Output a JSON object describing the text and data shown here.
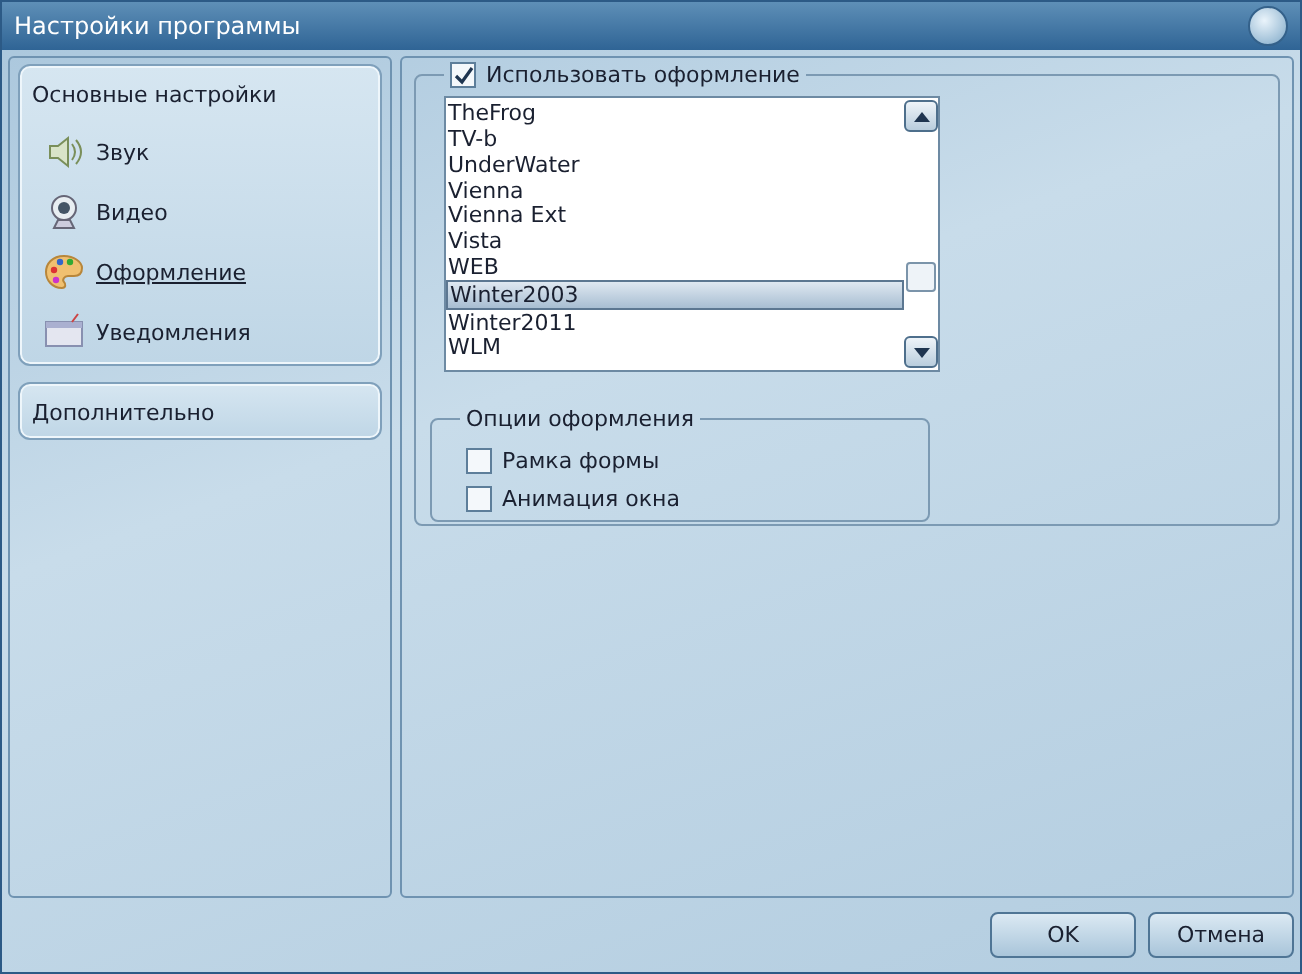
{
  "window": {
    "title": "Настройки программы"
  },
  "sidebar": {
    "sections": [
      {
        "title": "Основные настройки",
        "items": [
          {
            "label": "Звук",
            "selected": false
          },
          {
            "label": "Видео",
            "selected": false
          },
          {
            "label": "Оформление",
            "selected": true
          },
          {
            "label": "Уведомления",
            "selected": false
          }
        ]
      },
      {
        "title": "Дополнительно"
      }
    ]
  },
  "skins": {
    "use_skin": {
      "label": "Использовать оформление",
      "checked": true
    },
    "list": [
      {
        "label": "TheFrog",
        "selected": false
      },
      {
        "label": "TV-b",
        "selected": false
      },
      {
        "label": "UnderWater",
        "selected": false
      },
      {
        "label": "Vienna",
        "selected": false
      },
      {
        "label": "Vienna Ext",
        "selected": false
      },
      {
        "label": "Vista",
        "selected": false
      },
      {
        "label": "WEB",
        "selected": false
      },
      {
        "label": "Winter2003",
        "selected": true
      },
      {
        "label": "Winter2011",
        "selected": false
      },
      {
        "label": "WLM",
        "selected": false
      }
    ]
  },
  "options": {
    "title": "Опции оформления",
    "items": [
      {
        "label": "Рамка формы",
        "checked": false
      },
      {
        "label": "Анимация окна",
        "checked": false
      }
    ]
  },
  "buttons": [
    "OK",
    "Отмена"
  ]
}
